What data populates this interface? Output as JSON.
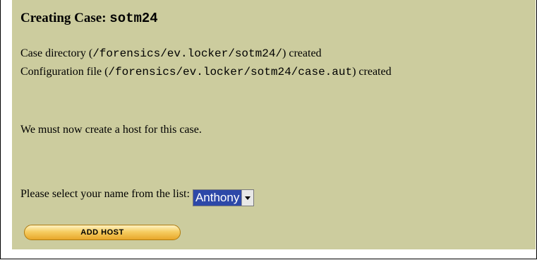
{
  "heading": {
    "prefix": "Creating Case: ",
    "case_name": "sotm24"
  },
  "messages": {
    "dir_prefix": "Case directory (",
    "dir_path": "/forensics/ev.locker/sotm24/",
    "dir_suffix": ") created",
    "config_prefix": "Configuration file (",
    "config_path": "/forensics/ev.locker/sotm24/case.aut",
    "config_suffix": ") created",
    "host_notice": "We must now create a host for this case."
  },
  "investigator": {
    "label": "Please select your name from the list:",
    "selected": "Anthony"
  },
  "actions": {
    "add_host": "ADD HOST"
  }
}
